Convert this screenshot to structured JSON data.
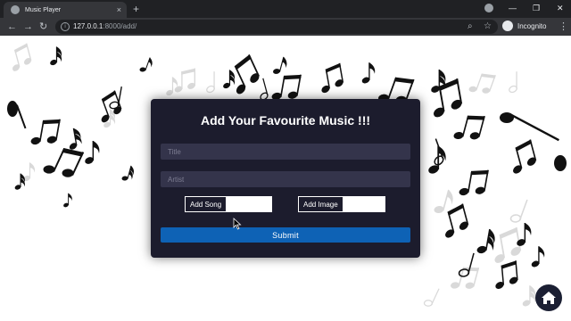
{
  "browser": {
    "tab_title": "Music Player",
    "tab_close": "×",
    "new_tab": "+",
    "window_minimize": "—",
    "window_restore": "❐",
    "window_close": "✕",
    "back": "←",
    "forward": "→",
    "reload": "↻",
    "url_host": "127.0.0.1",
    "url_rest": ":8000/add/",
    "zoom_icon": "⌕",
    "bookmark_icon": "☆",
    "profile_label": "Incognito",
    "menu_icon": "⋮"
  },
  "form": {
    "heading": "Add Your Favourite Music !!!",
    "title_placeholder": "Title",
    "artist_placeholder": "Artist",
    "add_song_label": "Add Song",
    "add_image_label": "Add Image",
    "submit_label": "Submit"
  },
  "colors": {
    "card_bg": "#1c1c2d",
    "field_bg": "#34344b",
    "submit_bg": "#0e62b5",
    "home_fab_bg": "#1b1f33"
  },
  "icons": {
    "home": "home-icon",
    "info": "info-icon",
    "incognito": "incognito-icon",
    "screen_record": "record-icon"
  }
}
